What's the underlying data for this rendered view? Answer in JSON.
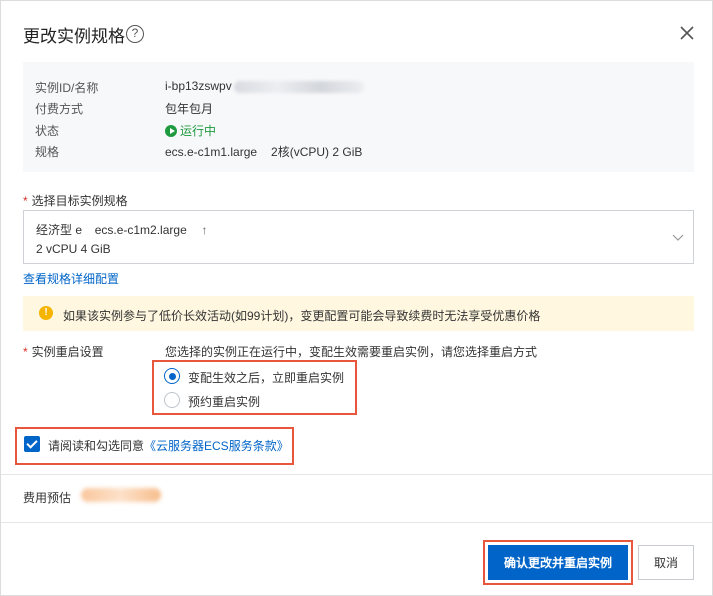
{
  "dialog": {
    "title": "更改实例规格",
    "help_icon": "question-circle-icon",
    "close_icon": "close-icon"
  },
  "current_instance": {
    "rows": [
      {
        "label": "实例ID/名称",
        "value": "i-bp13zswpv"
      },
      {
        "label": "付费方式",
        "value": "包年包月"
      },
      {
        "label": "状态",
        "value": "运行中"
      },
      {
        "label": "规格",
        "value": "ecs.e-c1m1.large",
        "extra": "2核(vCPU)  2 GiB"
      }
    ],
    "status_color": "#1f9a3e"
  },
  "target_spec": {
    "label": "选择目标实例规格",
    "family": "经济型 e",
    "name": "ecs.e-c1m2.large",
    "change_arrow": "↑",
    "resources": "2 vCPU   4 GiB",
    "detail_link": "查看规格详细配置"
  },
  "warning": {
    "icon": "warning-icon",
    "text": "如果该实例参与了低价长效活动(如99计划)，变更配置可能会导致续费时无法享受优惠价格"
  },
  "restart": {
    "label": "实例重启设置",
    "hint": "您选择的实例正在运行中，变配生效需要重启实例，请您选择重启方式",
    "options": [
      {
        "label": "变配生效之后，立即重启实例",
        "checked": true
      },
      {
        "label": "预约重启实例",
        "checked": false
      }
    ]
  },
  "agreement": {
    "text": "请阅读和勾选同意",
    "link": "《云服务器ECS服务条款》",
    "checked": true
  },
  "cost": {
    "label": "费用预估"
  },
  "footer": {
    "confirm_label": "确认更改并重启实例",
    "cancel_label": "取消"
  },
  "colors": {
    "primary": "#0064c8",
    "highlight": "#e8563b",
    "warning_bg": "#fff7df"
  }
}
